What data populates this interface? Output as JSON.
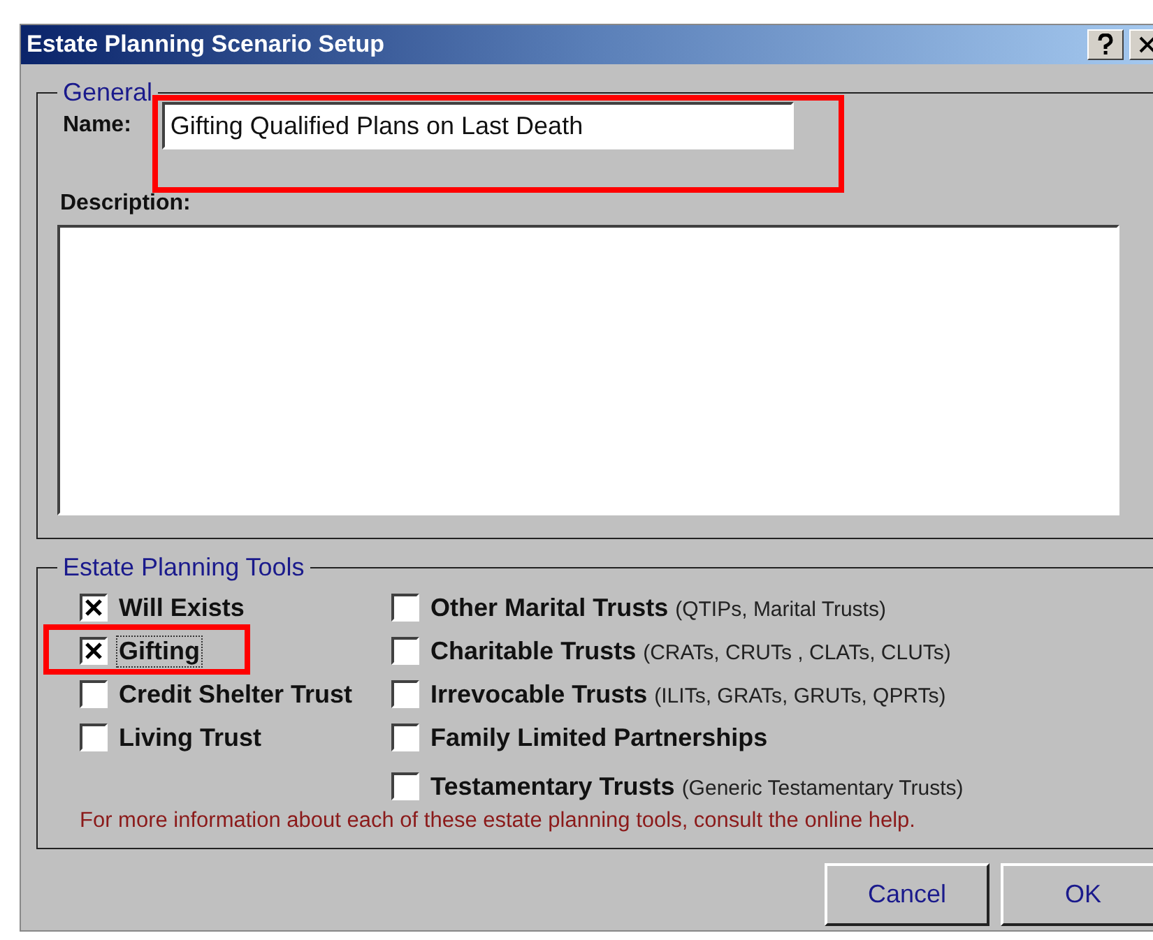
{
  "window": {
    "title": "Estate Planning Scenario Setup"
  },
  "general": {
    "legend": "General",
    "name_label": "Name:",
    "name_value": "Gifting Qualified Plans on Last Death",
    "description_label": "Description:"
  },
  "tools": {
    "legend": "Estate Planning Tools",
    "left": [
      {
        "label": "Will Exists",
        "checked": true,
        "focused": false
      },
      {
        "label": "Gifting",
        "checked": true,
        "focused": true
      },
      {
        "label": "Credit Shelter Trust",
        "checked": false,
        "focused": false
      },
      {
        "label": "Living Trust",
        "checked": false,
        "focused": false
      }
    ],
    "right": [
      {
        "label": "Other Marital Trusts",
        "note": "(QTIPs, Marital Trusts)",
        "checked": false
      },
      {
        "label": "Charitable Trusts",
        "note": "(CRATs, CRUTs , CLATs, CLUTs)",
        "checked": false
      },
      {
        "label": "Irrevocable Trusts",
        "note": "(ILITs, GRATs, GRUTs, QPRTs)",
        "checked": false
      },
      {
        "label": "Family Limited Partnerships",
        "checked": false
      },
      {
        "label": "Testamentary Trusts",
        "note": "(Generic Testamentary Trusts)",
        "checked": false
      }
    ],
    "info": "For more information about each of these estate planning tools, consult the online help."
  },
  "buttons": [
    "Cancel",
    "OK"
  ]
}
